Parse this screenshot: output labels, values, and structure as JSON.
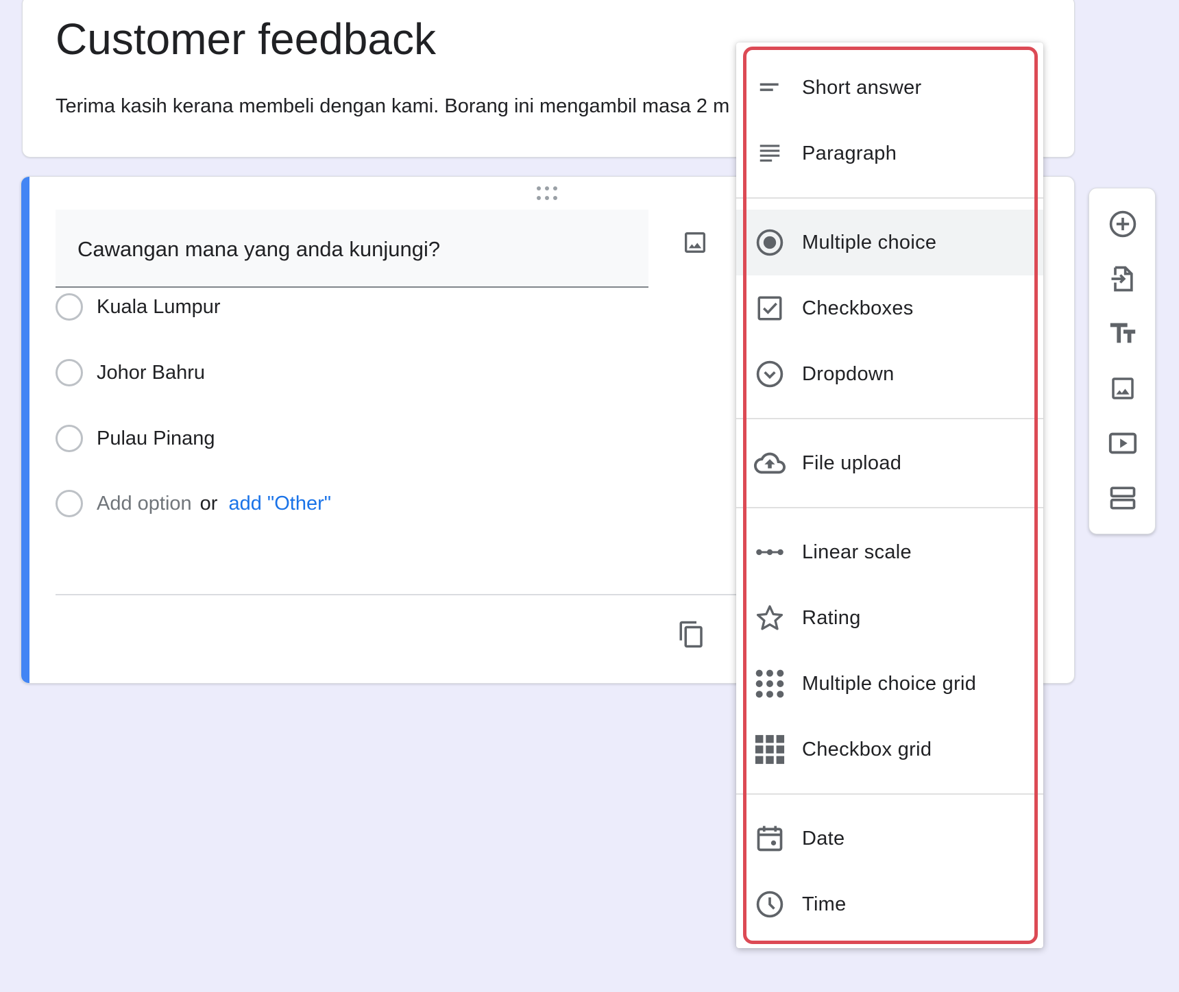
{
  "form": {
    "title": "Customer feedback",
    "description": "Terima kasih kerana membeli dengan kami. Borang ini mengambil masa 2 m"
  },
  "question": {
    "title": "Cawangan mana yang anda kunjungi?",
    "options": [
      "Kuala Lumpur",
      "Johor Bahru",
      "Pulau Pinang"
    ],
    "add_option": "Add option",
    "or": "or",
    "add_other": "add \"Other\""
  },
  "question_type_menu": {
    "items": [
      {
        "label": "Short answer",
        "icon": "short-text-icon"
      },
      {
        "label": "Paragraph",
        "icon": "paragraph-icon"
      },
      {
        "label": "Multiple choice",
        "icon": "radio-button-icon",
        "selected": true
      },
      {
        "label": "Checkboxes",
        "icon": "checkbox-icon"
      },
      {
        "label": "Dropdown",
        "icon": "dropdown-circle-icon"
      },
      {
        "label": "File upload",
        "icon": "cloud-upload-icon"
      },
      {
        "label": "Linear scale",
        "icon": "linear-scale-icon"
      },
      {
        "label": "Rating",
        "icon": "star-icon"
      },
      {
        "label": "Multiple choice grid",
        "icon": "dot-grid-icon"
      },
      {
        "label": "Checkbox grid",
        "icon": "square-grid-icon"
      },
      {
        "label": "Date",
        "icon": "calendar-icon"
      },
      {
        "label": "Time",
        "icon": "clock-icon"
      }
    ]
  },
  "toolbar": {
    "tools": [
      "add-question-icon",
      "import-questions-icon",
      "add-title-icon",
      "add-image-icon",
      "add-video-icon",
      "add-section-icon"
    ]
  },
  "colors": {
    "accent": "#4285f4",
    "link": "#1a73e8",
    "highlight_border": "#dc4a55",
    "background": "#ececfb"
  }
}
